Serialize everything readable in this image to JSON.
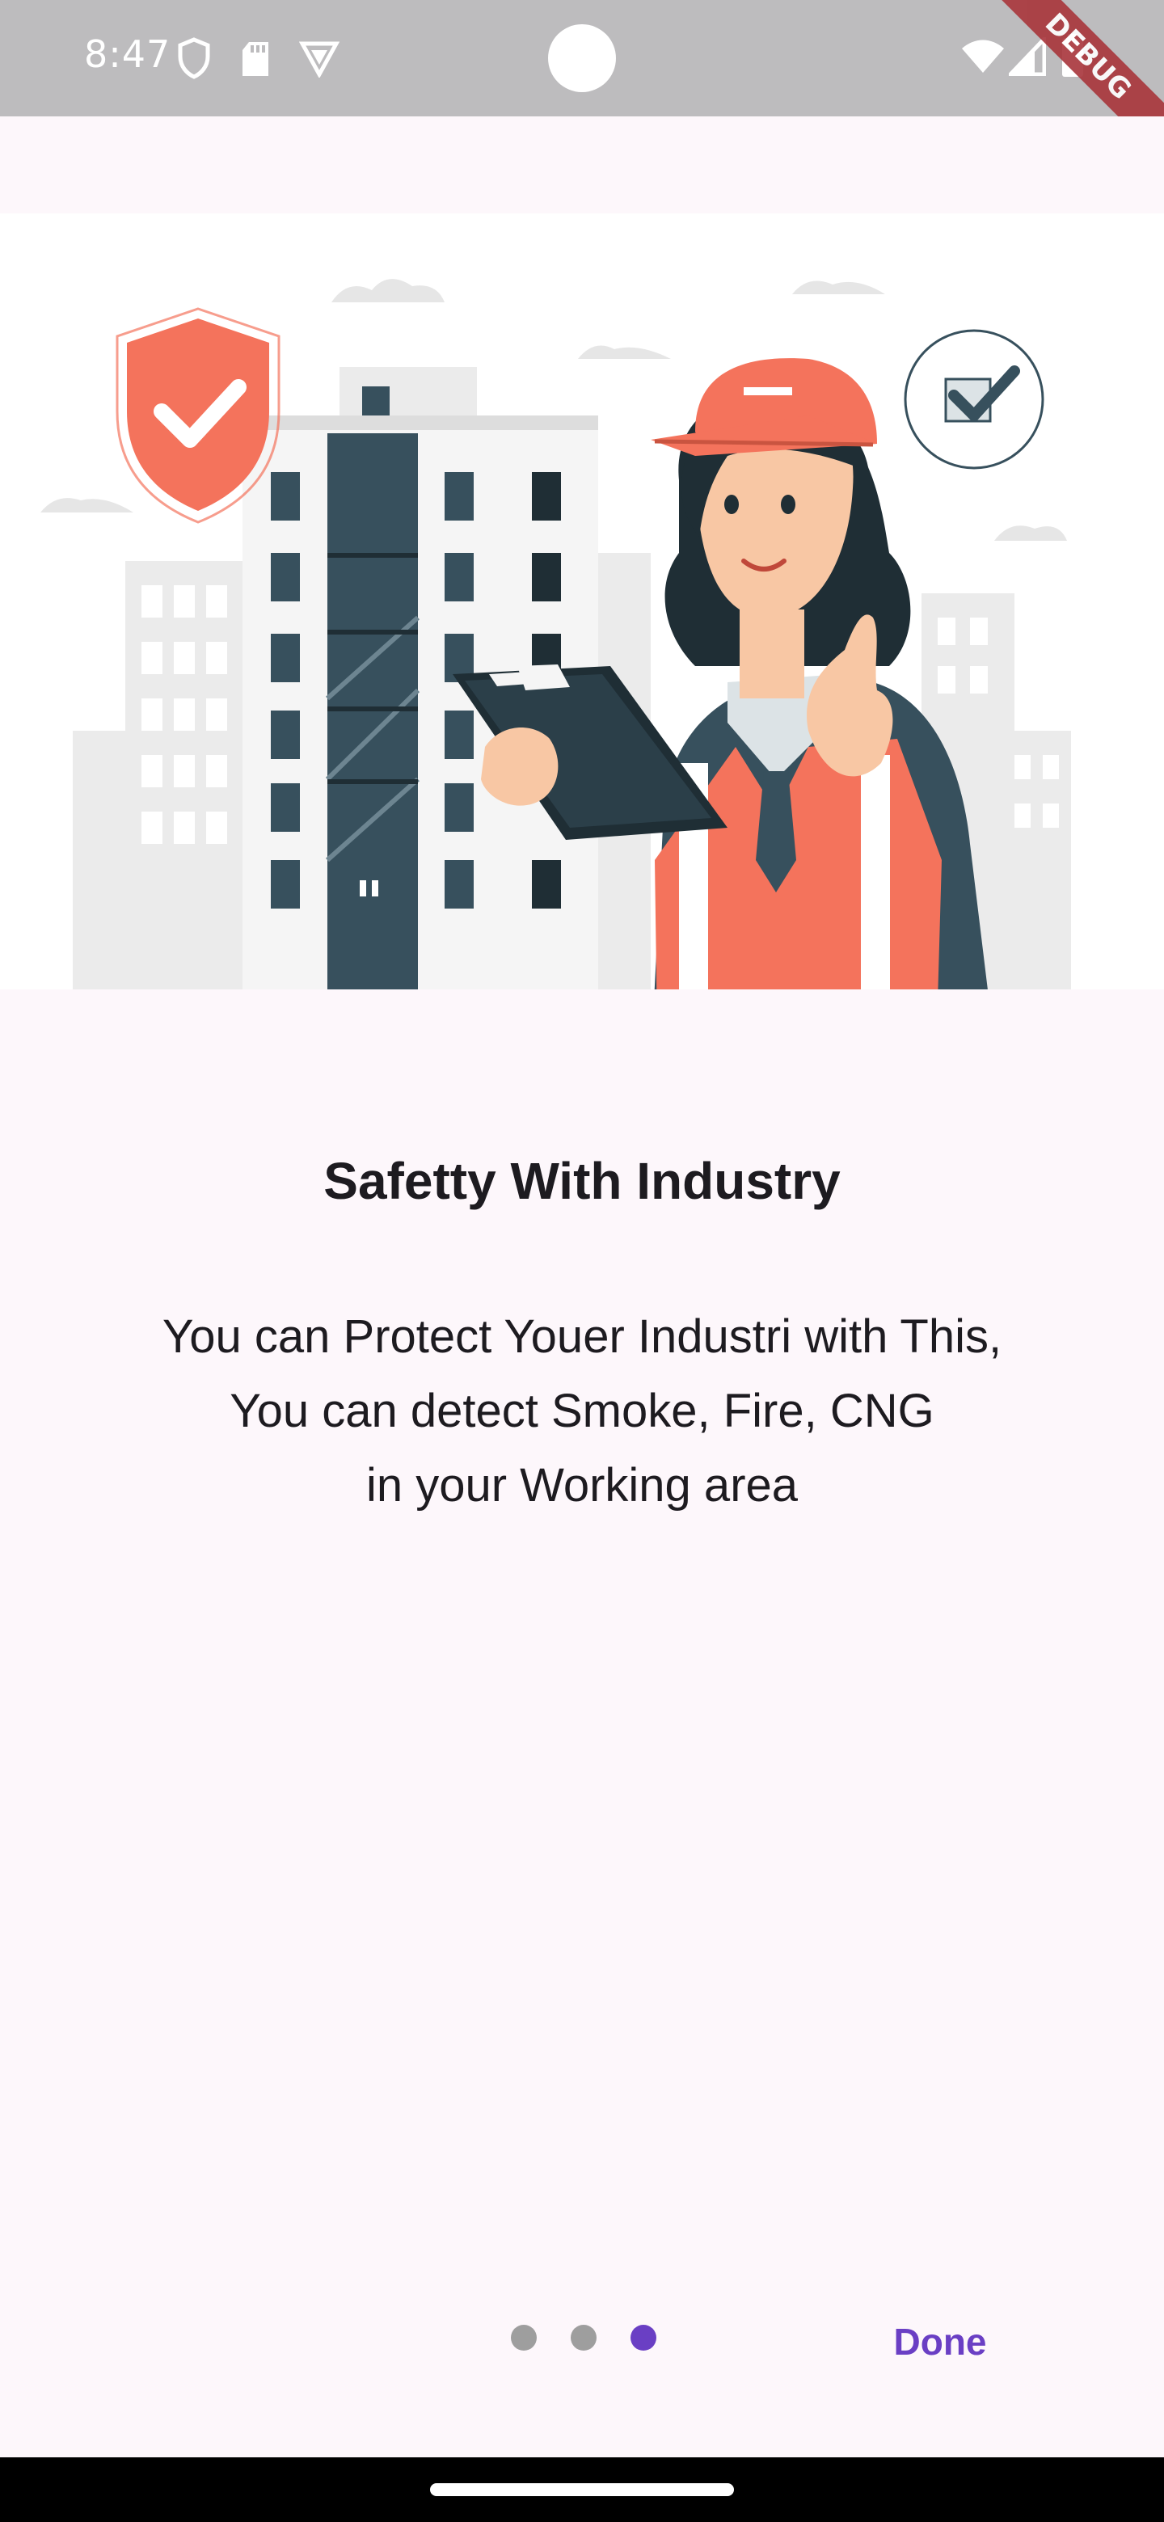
{
  "status_bar": {
    "time": "8:47",
    "left_icons": [
      "shield-icon",
      "sd-card-icon",
      "vpn-icon"
    ],
    "right_icons": [
      "wifi-icon",
      "signal-icon",
      "battery-icon"
    ],
    "debug_label": "DEBUG"
  },
  "onboarding": {
    "illustration": "safety-worker-illustration",
    "title": "Safetty With Industry",
    "body_lines": [
      "You can Protect Youer Industri with This,",
      "You can detect Smoke, Fire, CNG",
      "in your Working area"
    ]
  },
  "pager": {
    "page_count": 3,
    "current_page": 3,
    "done_label": "Done"
  },
  "colors": {
    "accent": "#6a3fc4",
    "inactive_dot": "#9e9e9e",
    "background": "#fdf7fb",
    "status_bar": "#bdbcbe",
    "illustration_orange": "#f4735c",
    "illustration_dark": "#37505d"
  }
}
